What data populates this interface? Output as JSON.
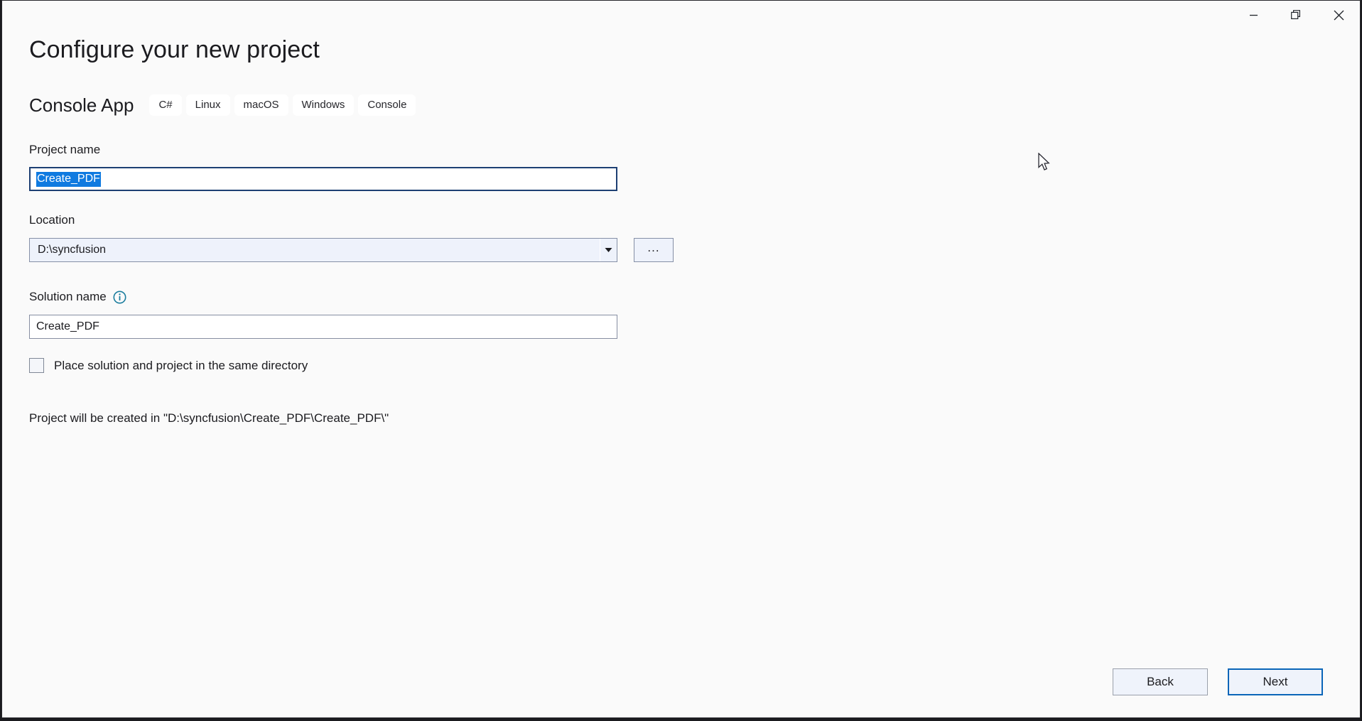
{
  "window": {
    "controls": [
      {
        "name": "minimize",
        "glyph": "minimize-icon"
      },
      {
        "name": "restore",
        "glyph": "restore-icon"
      },
      {
        "name": "close",
        "glyph": "close-icon"
      }
    ]
  },
  "header": {
    "title": "Configure your new project",
    "template_name": "Console App",
    "tags": [
      "C#",
      "Linux",
      "macOS",
      "Windows",
      "Console"
    ]
  },
  "form": {
    "project_name": {
      "label": "Project name",
      "value": "Create_PDF",
      "selected": true
    },
    "location": {
      "label": "Location",
      "value": "D:\\syncfusion",
      "browse_label": "...",
      "dropdown_icon": "chevron-down-icon"
    },
    "solution_name": {
      "label": "Solution name",
      "value": "Create_PDF",
      "info_icon": "info-icon"
    },
    "same_directory": {
      "label": "Place solution and project in the same directory",
      "checked": false
    },
    "created_in": "Project will be created in \"D:\\syncfusion\\Create_PDF\\Create_PDF\\\""
  },
  "footer": {
    "back_label": "Back",
    "next_label": "Next"
  },
  "colors": {
    "page_background": "#fafafa",
    "accent_blue": "#0a65b8",
    "selection_blue": "#0f7ae0",
    "focus_border": "#1d3f73",
    "info_icon": "#1b7d9e",
    "combo_background": "#eef2fb"
  }
}
